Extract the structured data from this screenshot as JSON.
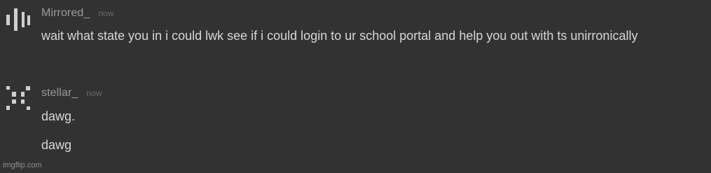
{
  "messages": [
    {
      "username": "Mirrored_",
      "timestamp": "now",
      "avatar_icon": "bars-pixel-avatar-icon",
      "lines": [
        "wait what state you in i could lwk see if i could login to ur school portal and help you out with ts unirronically"
      ]
    },
    {
      "username": "stellar_",
      "timestamp": "now",
      "avatar_icon": "dots-pixel-avatar-icon",
      "lines": [
        "dawg.",
        "dawg"
      ]
    }
  ],
  "watermark": "imgflip.com",
  "colors": {
    "background": "#323233",
    "username": "#9b9b9c",
    "timestamp": "#6c6c6e",
    "message_text": "#d7d7d8",
    "avatar": "#cfcfd0"
  }
}
